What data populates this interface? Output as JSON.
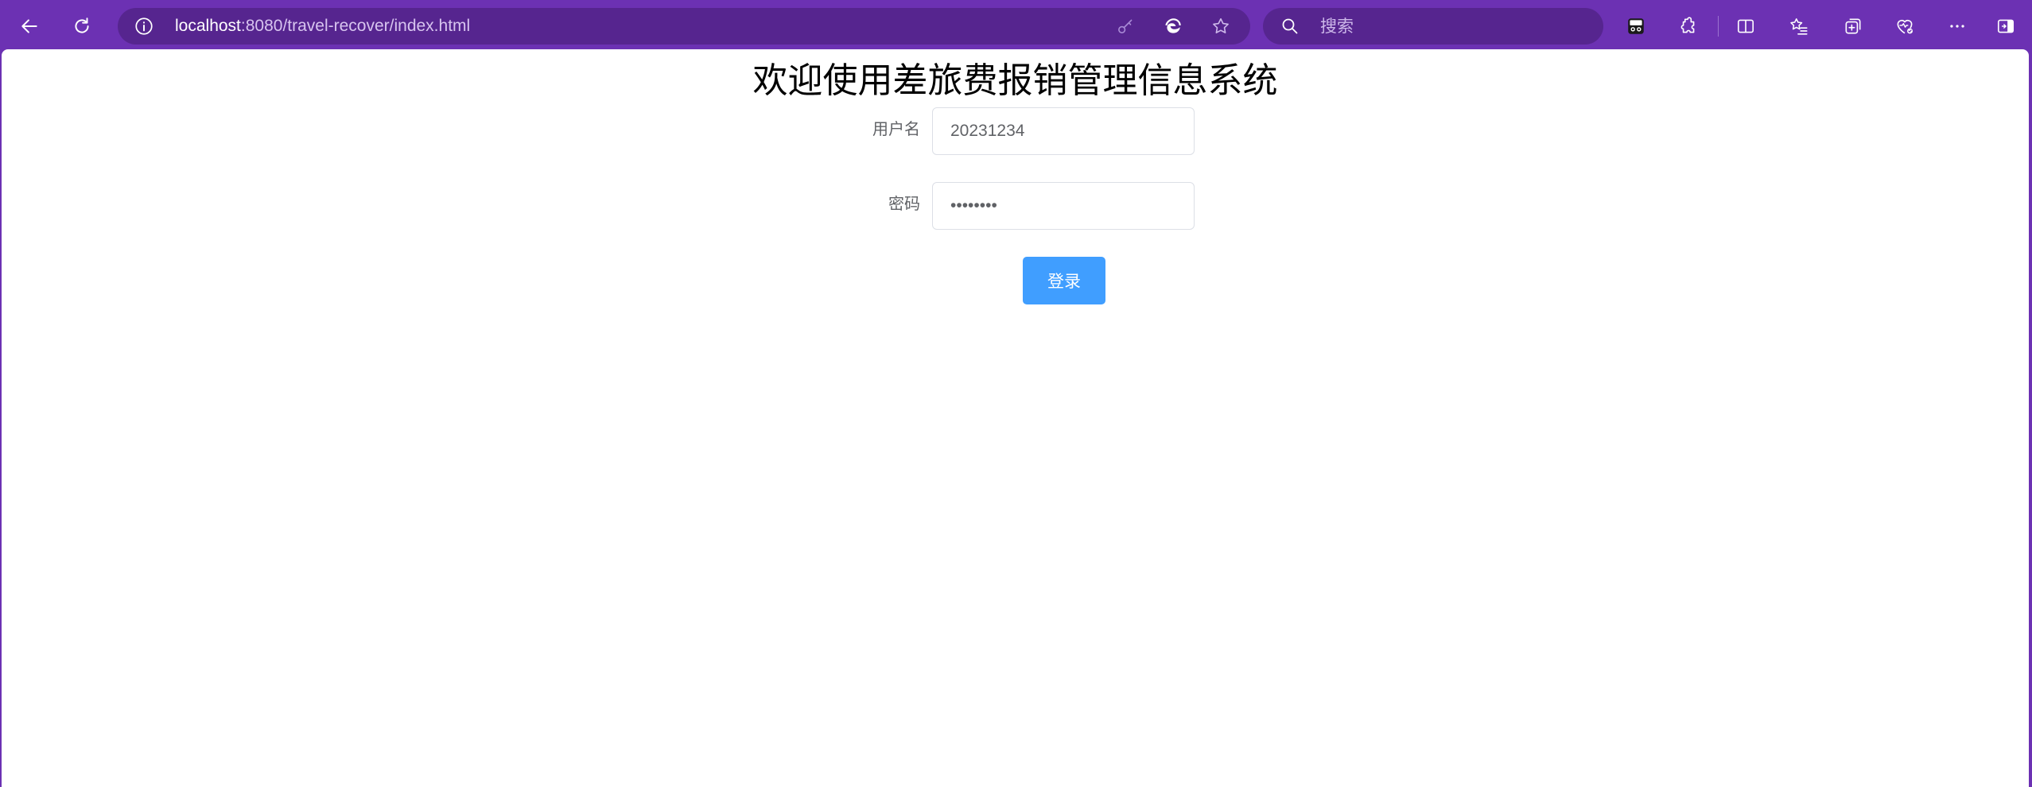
{
  "browser": {
    "url_host": "localhost",
    "url_rest": ":8080/travel-recover/index.html",
    "search_placeholder": "搜索",
    "accent_color": "#6c31b3"
  },
  "page": {
    "title": "欢迎使用差旅费报销管理信息系统",
    "form": {
      "username_label": "用户名",
      "username_value": "20231234",
      "password_label": "密码",
      "password_value": "12345678",
      "login_label": "登录"
    },
    "button_color": "#409eff"
  }
}
